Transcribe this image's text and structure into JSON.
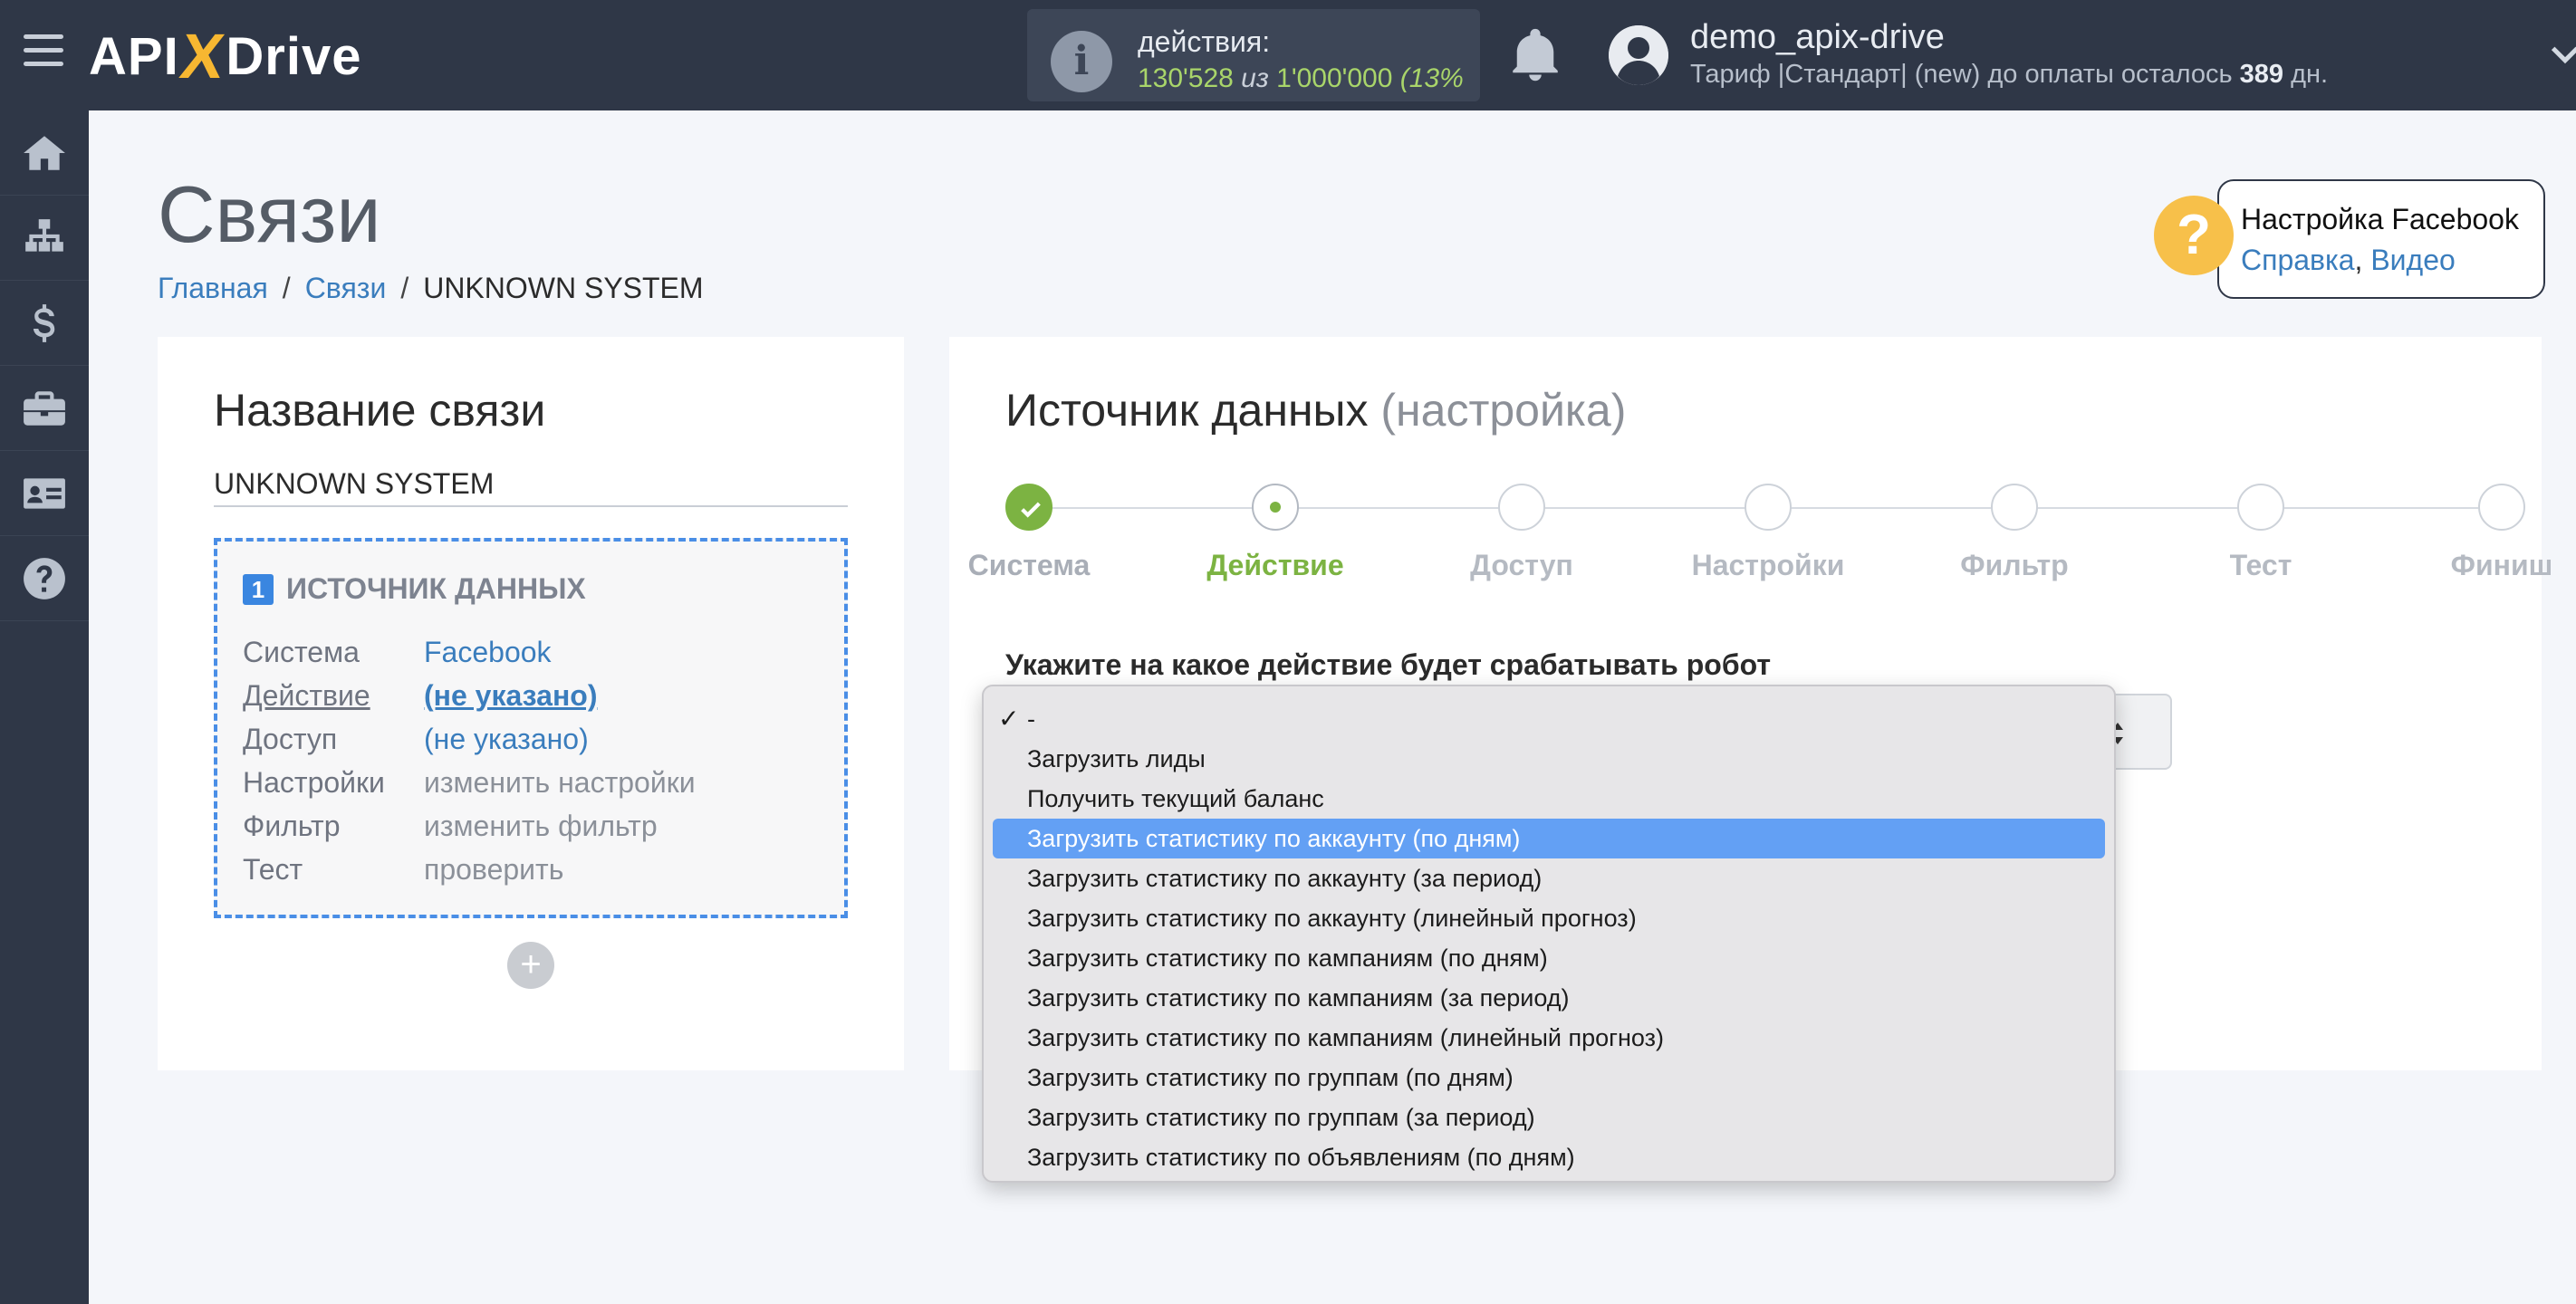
{
  "brand": {
    "logo_left": "API",
    "logo_x": "X",
    "logo_right": "Drive"
  },
  "header": {
    "actions_label": "действия:",
    "actions_used": "130'528",
    "actions_sep": " из ",
    "actions_total": "1'000'000",
    "actions_pct": " (13%",
    "user_name": "demo_apix-drive",
    "plan_text": "Тариф |Стандарт| (new) до оплаты осталось ",
    "plan_days": "389",
    "plan_suffix": " дн."
  },
  "sidebar": {
    "items": [
      {
        "icon": "home-icon"
      },
      {
        "icon": "sitemap-icon"
      },
      {
        "icon": "dollar-icon"
      },
      {
        "icon": "briefcase-icon"
      },
      {
        "icon": "id-card-icon"
      },
      {
        "icon": "question-icon"
      }
    ]
  },
  "page": {
    "title": "Связи",
    "breadcrumb": {
      "home": "Главная",
      "links": "Связи",
      "current": "UNKNOWN SYSTEM"
    }
  },
  "help": {
    "title": "Настройка Facebook",
    "link1": "Справка",
    "comma": ",",
    "link2": "Видео",
    "icon": "?"
  },
  "left_card": {
    "heading": "Название связи",
    "name_value": "UNKNOWN SYSTEM",
    "source": {
      "num": "1",
      "title": "ИСТОЧНИК ДАННЫХ",
      "rows": [
        {
          "k": "Система",
          "v": "Facebook"
        },
        {
          "k": "Действие",
          "v": "(не указано)"
        },
        {
          "k": "Доступ",
          "v": "(не указано)"
        },
        {
          "k": "Настройки",
          "v": "изменить настройки"
        },
        {
          "k": "Фильтр",
          "v": "изменить фильтр"
        },
        {
          "k": "Тест",
          "v": "проверить"
        }
      ]
    },
    "add": "+"
  },
  "right_card": {
    "heading": "Источник данных",
    "heading_muted": " (настройка)",
    "steps": [
      "Система",
      "Действие",
      "Доступ",
      "Настройки",
      "Фильтр",
      "Тест",
      "Финиш"
    ],
    "question": "Укажите на какое действие будет срабатывать робот"
  },
  "dropdown": {
    "check": "✓",
    "options": [
      "-",
      "Загрузить лиды",
      "Получить текущий баланс",
      "Загрузить статистику по аккаунту (по дням)",
      "Загрузить статистику по аккаунту (за период)",
      "Загрузить статистику по аккаунту (линейный прогноз)",
      "Загрузить статистику по кампаниям (по дням)",
      "Загрузить статистику по кампаниям (за период)",
      "Загрузить статистику по кампаниям (линейный прогноз)",
      "Загрузить статистику по группам (по дням)",
      "Загрузить статистику по группам (за период)",
      "Загрузить статистику по объявлениям (по дням)"
    ]
  },
  "colors": {
    "topbar": "#2f3747",
    "accent_green": "#7cb342",
    "link_blue": "#3a7dbd",
    "highlight": "#63a0f4",
    "help_yellow": "#f7c04a"
  }
}
